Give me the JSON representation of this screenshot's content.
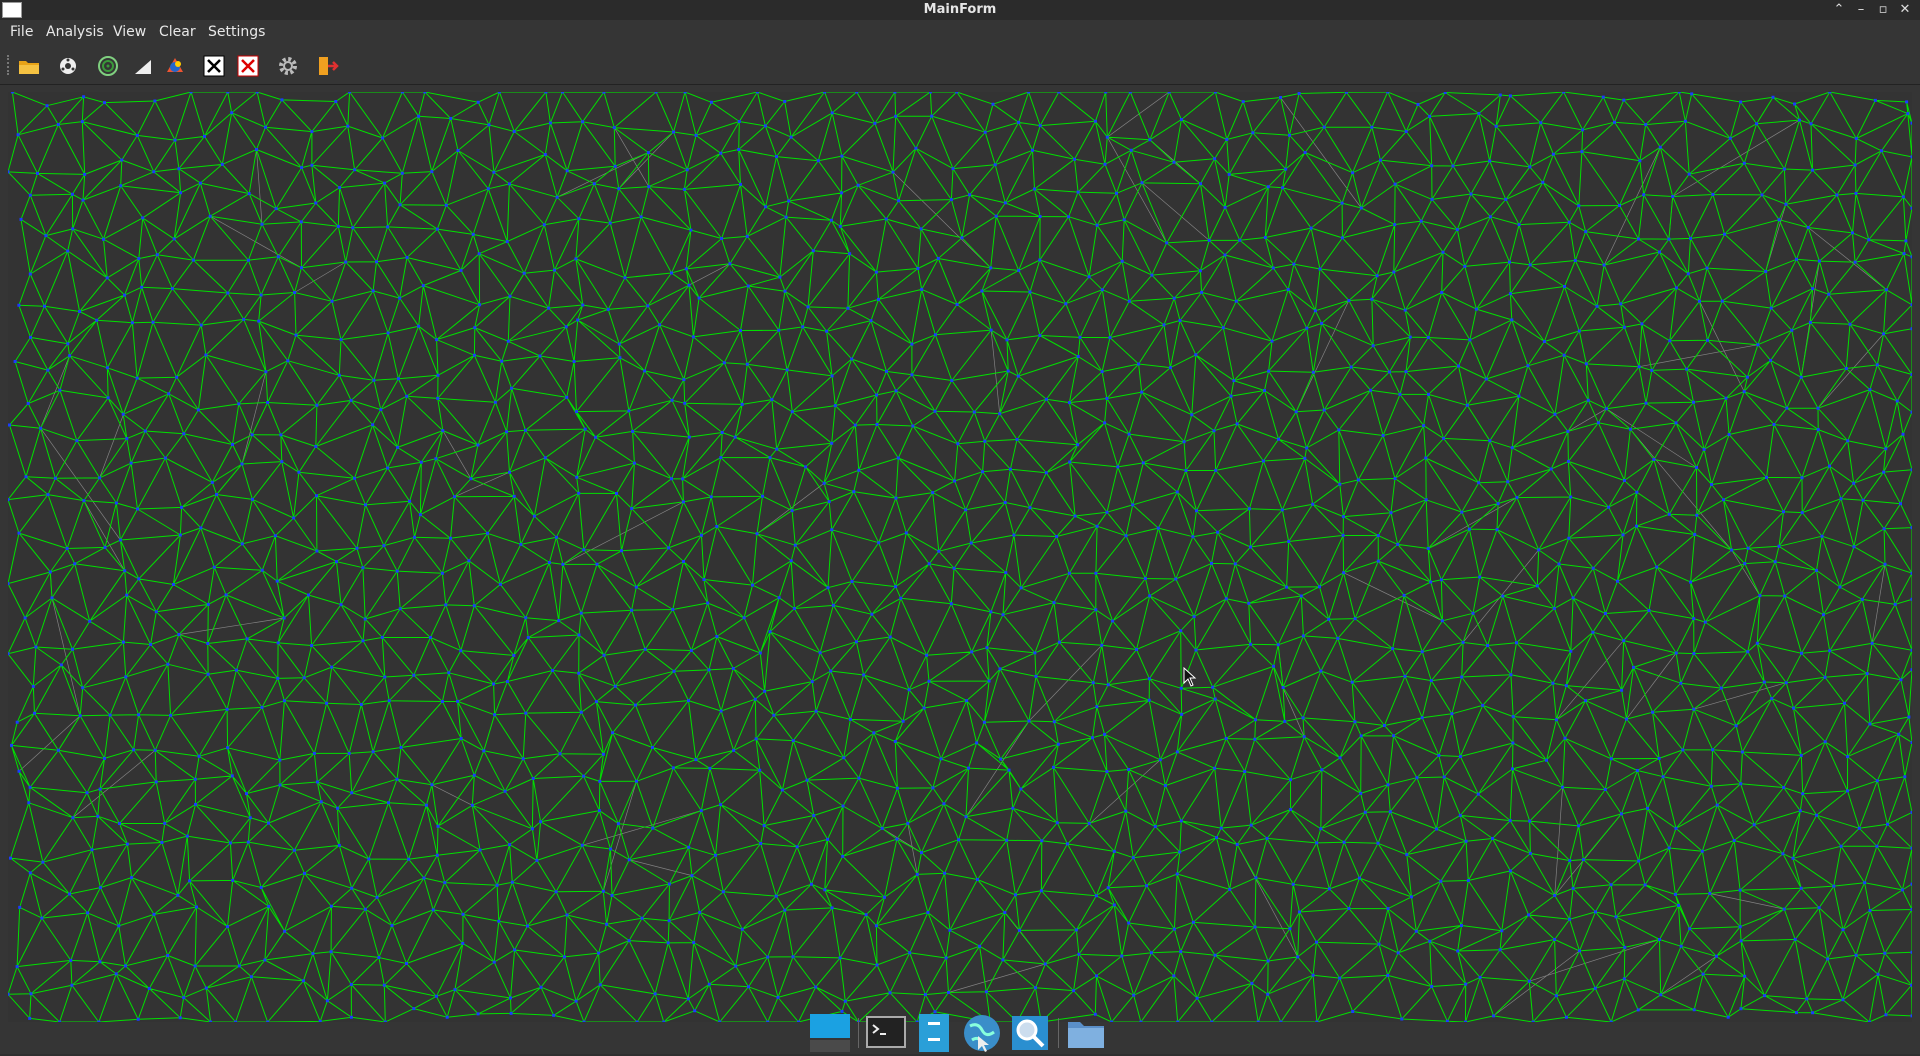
{
  "window": {
    "title": "MainForm"
  },
  "window_controls": {
    "restore": "⌃",
    "minimize": "–",
    "maximize": "▫",
    "close": "✕"
  },
  "menubar": {
    "items": [
      {
        "label": "File"
      },
      {
        "label": "Analysis"
      },
      {
        "label": "View"
      },
      {
        "label": "Clear"
      },
      {
        "label": "Settings"
      }
    ]
  },
  "toolbar": {
    "buttons": [
      {
        "name": "open-folder-icon"
      },
      {
        "name": "point-cloud-icon"
      },
      {
        "name": "spiral-icon"
      },
      {
        "name": "triangle-icon"
      },
      {
        "name": "color-wheel-icon"
      },
      {
        "name": "clear-black-icon"
      },
      {
        "name": "clear-red-icon"
      },
      {
        "name": "gear-icon"
      },
      {
        "name": "exit-icon"
      }
    ]
  },
  "colors": {
    "edge_primary": "#00e000",
    "edge_secondary": "#b8b8b8",
    "vertex": "#1a3cff",
    "background": "#333333"
  },
  "taskbar": {
    "items": [
      {
        "name": "desktop-icon"
      },
      {
        "name": "terminal-icon"
      },
      {
        "name": "file-manager-icon"
      },
      {
        "name": "browser-icon"
      },
      {
        "name": "search-icon"
      },
      {
        "name": "folder-icon"
      }
    ]
  }
}
